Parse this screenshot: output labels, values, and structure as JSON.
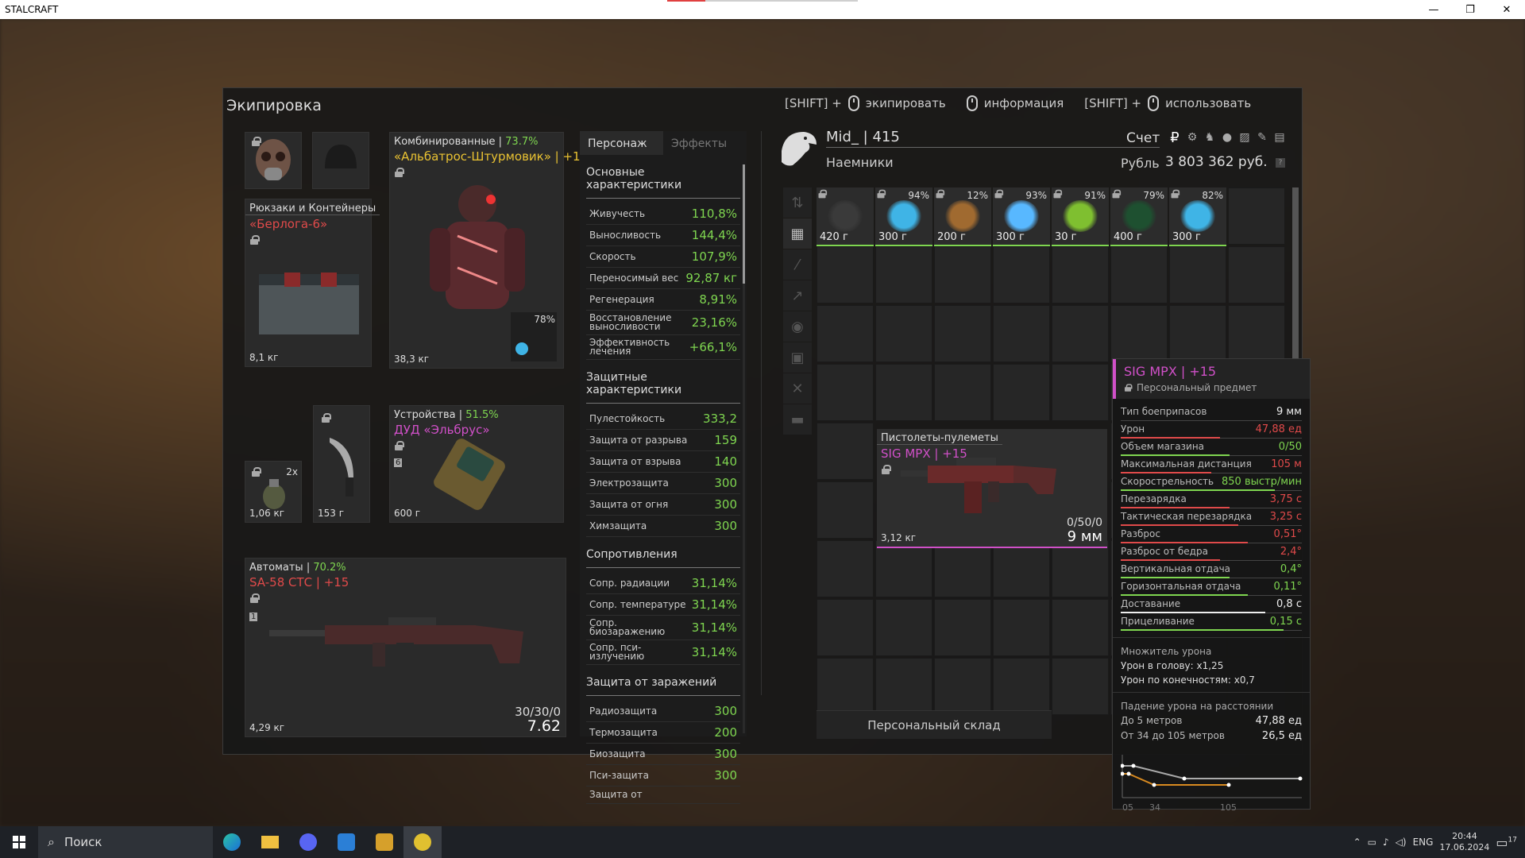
{
  "window": {
    "app_title": "STALCRAFT",
    "minimize": "—",
    "restore": "❐",
    "close": "✕"
  },
  "equipment": {
    "title": "Экипировка",
    "hints": [
      {
        "prefix": "[SHIFT] +",
        "label": "экипировать"
      },
      {
        "prefix": "",
        "label": "информация"
      },
      {
        "prefix": "[SHIFT] +",
        "label": "использовать"
      }
    ],
    "backpack": {
      "category": "Рюкзаки и Контейнеры",
      "name": "«Берлога-6»",
      "weight": "8,1 кг"
    },
    "armor": {
      "category": "Комбинированные | ",
      "percent": "73.7%",
      "name": "«Альбатрос-Штурмовик» | +15",
      "weight": "38,3 кг",
      "artifact_percent": "78%"
    },
    "grenade": {
      "count": "2x",
      "weight": "1,06 кг"
    },
    "knife": {
      "weight": "153 г"
    },
    "device": {
      "category": "Устройства | ",
      "percent": "51.5%",
      "name": "ДУД «Эльбрус»",
      "slot_number": "6",
      "weight": "600 г"
    },
    "primary": {
      "category": "Автоматы | ",
      "percent": "70.2%",
      "name": "SA-58 СТС | +15",
      "slot_number": "1",
      "weight": "4,29 кг",
      "ammo": "30/30/0",
      "caliber": "7.62"
    }
  },
  "stats": {
    "tabs": [
      "Персонаж",
      "Эффекты"
    ],
    "sections": [
      {
        "title": "Основные характеристики",
        "rows": [
          {
            "k": "Живучесть",
            "v": "110,8%"
          },
          {
            "k": "Выносливость",
            "v": "144,4%"
          },
          {
            "k": "Скорость",
            "v": "107,9%"
          },
          {
            "k": "Переносимый вес",
            "v": "92,87 кг"
          },
          {
            "k": "Регенерация",
            "v": "8,91%"
          },
          {
            "k": "Восстановление выносливости",
            "v": "23,16%"
          },
          {
            "k": "Эффективность лечения",
            "v": "+66,1%"
          }
        ]
      },
      {
        "title": "Защитные характеристики",
        "rows": [
          {
            "k": "Пулестойкость",
            "v": "333,2"
          },
          {
            "k": "Защита от разрыва",
            "v": "159"
          },
          {
            "k": "Защита от взрыва",
            "v": "140"
          },
          {
            "k": "Электрозащита",
            "v": "300"
          },
          {
            "k": "Защита от огня",
            "v": "300"
          },
          {
            "k": "Химзащита",
            "v": "300"
          }
        ]
      },
      {
        "title": "Сопротивления",
        "rows": [
          {
            "k": "Сопр. радиации",
            "v": "31,14%"
          },
          {
            "k": "Сопр. температуре",
            "v": "31,14%"
          },
          {
            "k": "Сопр. биозаражению",
            "v": "31,14%"
          },
          {
            "k": "Сопр. пси-излучению",
            "v": "31,14%"
          }
        ]
      },
      {
        "title": "Защита от заражений",
        "rows": [
          {
            "k": "Радиозащита",
            "v": "300"
          },
          {
            "k": "Термозащита",
            "v": "200"
          },
          {
            "k": "Биозащита",
            "v": "300"
          },
          {
            "k": "Пси-защита",
            "v": "300"
          },
          {
            "k": "Защита от",
            "v": ""
          }
        ]
      }
    ]
  },
  "player": {
    "name": "Mid_ | 415",
    "faction": "Наемники",
    "account_label": "Счет",
    "currency_label": "Рубль",
    "money": "3 803 362 руб.",
    "help": "?"
  },
  "sidebar_icons": [
    "sort-icon",
    "grid-icon",
    "rifle-icon",
    "knife-icon",
    "grenade-icon",
    "box-icon",
    "tools-icon",
    "storage-icon"
  ],
  "inventory": [
    {
      "pct": "",
      "weight": "420 г",
      "color": "#3a3a3a"
    },
    {
      "pct": "94%",
      "weight": "300 г",
      "color": "#3fb4e6"
    },
    {
      "pct": "12%",
      "weight": "200 г",
      "color": "#a06a30"
    },
    {
      "pct": "93%",
      "weight": "300 г",
      "color": "#58b8ff"
    },
    {
      "pct": "91%",
      "weight": "30 г",
      "color": "#7fbf30"
    },
    {
      "pct": "79%",
      "weight": "400 г",
      "color": "#1e5030"
    },
    {
      "pct": "82%",
      "weight": "300 г",
      "color": "#3fb4e6"
    }
  ],
  "weapon_card": {
    "category": "Пистолеты-пулеметы",
    "name": "SIG MPX | +15",
    "weight": "3,12 кг",
    "ammo": "0/50/0",
    "caliber": "9 мм"
  },
  "storage_button": "Персональный склад",
  "tooltip": {
    "title": "SIG MPX | +15",
    "subtitle": "Персональный предмет",
    "rows": [
      {
        "k": "Тип боеприпасов",
        "v": "9 мм",
        "c": "w",
        "bar": 0
      },
      {
        "k": "Урон",
        "v": "47,88 ед",
        "c": "r",
        "bar": 0.55
      },
      {
        "k": "Объем магазина",
        "v": "0/50",
        "c": "g",
        "bar": 0.6
      },
      {
        "k": "Максимальная дистанция",
        "v": "105 м",
        "c": "r",
        "bar": 0.5
      },
      {
        "k": "Скорострельность",
        "v": "850 выстр/мин",
        "c": "g",
        "bar": 0.85
      },
      {
        "k": "Перезарядка",
        "v": "3,75 с",
        "c": "r",
        "bar": 0.6
      },
      {
        "k": "Тактическая перезарядка",
        "v": "3,25 с",
        "c": "r",
        "bar": 0.65
      },
      {
        "k": "Разброс",
        "v": "0,51°",
        "c": "r",
        "bar": 0.7
      },
      {
        "k": "Разброс от бедра",
        "v": "2,4°",
        "c": "r",
        "bar": 0.55
      },
      {
        "k": "Вертикальная отдача",
        "v": "0,4°",
        "c": "g",
        "bar": 0.6
      },
      {
        "k": "Горизонтальная отдача",
        "v": "0,11°",
        "c": "g",
        "bar": 0.7
      },
      {
        "k": "Доставание",
        "v": "0,8 с",
        "c": "w",
        "bar": 0.8
      },
      {
        "k": "Прицеливание",
        "v": "0,15 с",
        "c": "g",
        "bar": 0.9
      }
    ],
    "multiplier_title": "Множитель урона",
    "head": "Урон в голову: x1,25",
    "limbs": "Урон по конечностям: x0,7",
    "falloff_title": "Падение урона на расстоянии",
    "falloff": [
      {
        "k": "До 5 метров",
        "v": "47,88 ед"
      },
      {
        "k": "От 34 до 105 метров",
        "v": "26,5 ед"
      }
    ],
    "chart_labels": [
      "05",
      "34",
      "105"
    ]
  },
  "taskbar": {
    "search": "Поиск",
    "lang": "ENG",
    "time": "20:44",
    "date": "17.06.2024",
    "notifications": "17"
  }
}
